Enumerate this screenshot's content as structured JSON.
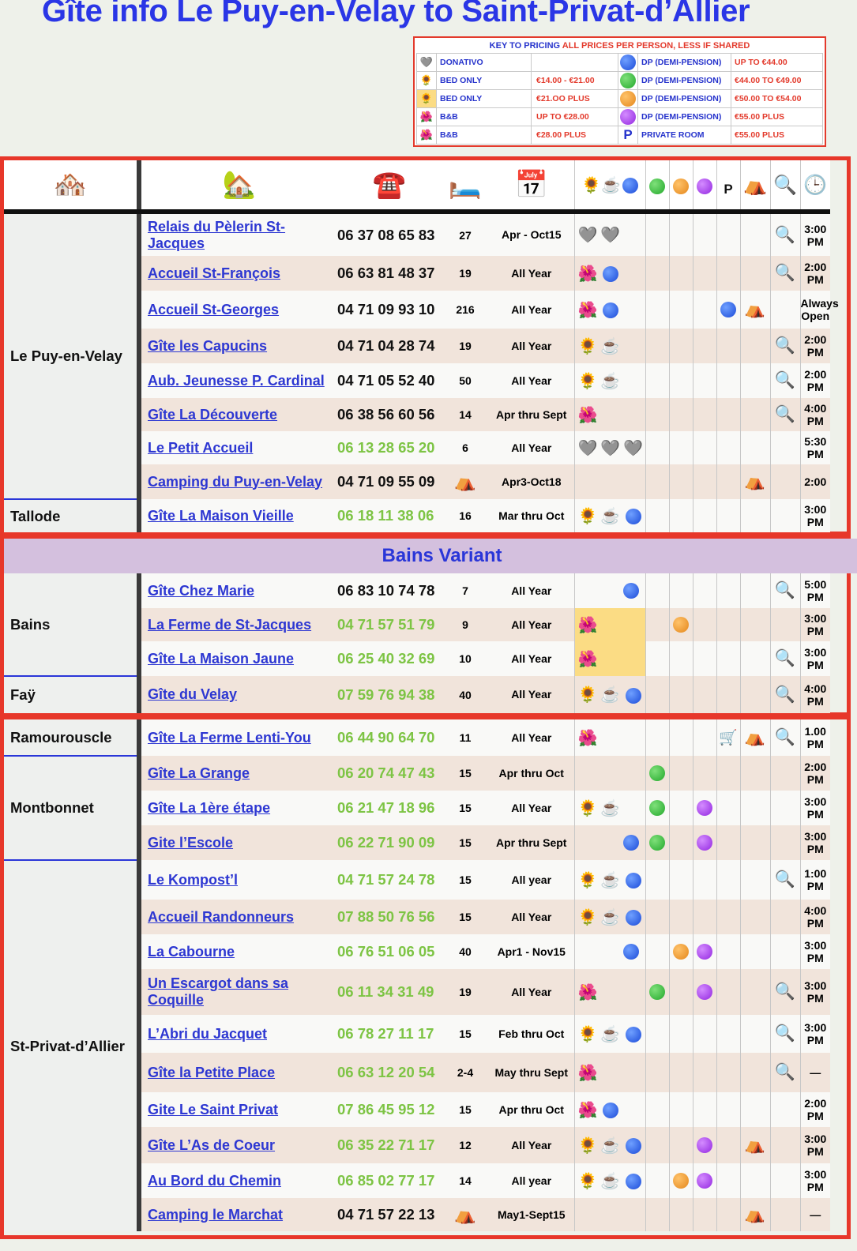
{
  "title": "Gîte info Le Puy-en-Velay to Saint-Privat-d’Allier",
  "key": {
    "heading_a": "KEY TO PRICING ",
    "heading_b": "ALL PRICES PER PERSON, LESS IF SHARED",
    "rows": [
      {
        "icon_a": "🩶",
        "label_a": "DONATIVO",
        "price_a": "",
        "icon_b": "blue-dot",
        "label_b": "DP (DEMI-PENSION)",
        "price_b": "UP TO €44.00"
      },
      {
        "icon_a": "🌻",
        "label_a": "BED ONLY",
        "price_a": "€14.00 - €21.00",
        "icon_b": "green-dot",
        "label_b": "DP (DEMI-PENSION)",
        "price_b": "€44.00 TO €49.00"
      },
      {
        "icon_a": "🌻",
        "label_a": "BED ONLY",
        "price_a": "€21.OO PLUS",
        "icon_b": "orange-dot",
        "label_b": "DP (DEMI-PENSION)",
        "price_b": "€50.00 TO €54.00"
      },
      {
        "icon_a": "🌺",
        "label_a": "B&B",
        "price_a": "UP TO €28.00",
        "icon_b": "purple-dot",
        "label_b": "DP (DEMI-PENSION)",
        "price_b": "€55.00 PLUS"
      },
      {
        "icon_a": "🌺",
        "label_a": "B&B",
        "price_a": "€28.00 PLUS",
        "icon_b": "P",
        "label_b": "PRIVATE ROOM",
        "price_b": "€55.00 PLUS"
      }
    ]
  },
  "header_icons": [
    "house-icon",
    "tree-house-icon",
    "telephone-icon",
    "bed-icon",
    "calendar-icon",
    "sunflower-icon",
    "coffee-icon",
    "blue-dot",
    "green-dot",
    "orange-dot",
    "purple-dot",
    "P",
    "tent-icon",
    "magnifier-icon",
    "clock-icon"
  ],
  "header_glyphs": {
    "house": "🏘️",
    "tree": "🏡",
    "phone": "☎️",
    "bed": "🛏️",
    "cal": "📅",
    "sun": "🌻",
    "coffee": "☕",
    "p": "P",
    "tent": "⛺",
    "mag": "🔍",
    "clock": "🕒"
  },
  "section1": {
    "rows": [
      {
        "loc": "",
        "name": "Relais du Pèlerin St-Jacques",
        "phone": "06 37 08 65 83",
        "pc": "b",
        "beds": "27",
        "open": "Apr - Oct15",
        "time": "3:00 PM"
      },
      {
        "loc": "",
        "name": "Accueil St-François",
        "phone": "06 63 81 48 37",
        "pc": "b",
        "beds": "19",
        "open": "All Year",
        "time": "2:00 PM"
      },
      {
        "loc": "",
        "name": "Accueil St-Georges",
        "phone": "04 71 09 93 10",
        "pc": "b",
        "beds": "216",
        "open": "All Year",
        "time": "Always Open"
      },
      {
        "loc": "Le Puy-en-Velay",
        "name": "Gîte les Capucins",
        "phone": "04 71 04 28 74",
        "pc": "b",
        "beds": "19",
        "open": "All Year",
        "time": "2:00 PM"
      },
      {
        "loc": "",
        "name": "Aub. Jeunesse P. Cardinal",
        "phone": "04 71 05 52 40",
        "pc": "b",
        "beds": "50",
        "open": "All Year",
        "time": "2:00 PM"
      },
      {
        "loc": "",
        "name": "Gîte La Découverte",
        "phone": "06 38 56 60 56",
        "pc": "b",
        "beds": "14",
        "open": "Apr thru Sept",
        "time": "4:00 PM"
      },
      {
        "loc": "",
        "name": "Le Petit Accueil",
        "phone": "06 13 28 65 20",
        "pc": "g",
        "beds": "6",
        "open": "All Year",
        "time": "5:30 PM"
      },
      {
        "loc": "",
        "name": "Camping du Puy-en-Velay",
        "phone": "04 71 09 55 09",
        "pc": "b",
        "beds": "⛺",
        "open": "Apr3-Oct18",
        "time": "2:00"
      },
      {
        "loc": "Tallode",
        "name": "Gîte La Maison Vieille",
        "phone": "06 18 11 38 06",
        "pc": "g",
        "beds": "16",
        "open": "Mar thru Oct",
        "time": "3:00 PM"
      }
    ]
  },
  "section2": {
    "band": "Bains Variant",
    "rows": [
      {
        "loc": "Bains",
        "name": "Gîte Chez Marie",
        "phone": "06 83 10 74 78",
        "pc": "b",
        "beds": "7",
        "open": "All Year",
        "time": "5:00 PM"
      },
      {
        "loc": "",
        "name": "La Ferme de St-Jacques",
        "phone": "04 71 57 51 79",
        "pc": "g",
        "beds": "9",
        "open": "All Year",
        "time": "3:00 PM"
      },
      {
        "loc": "",
        "name": "Gîte La Maison Jaune",
        "phone": "06 25 40 32 69",
        "pc": "g",
        "beds": "10",
        "open": "All Year",
        "time": "3:00 PM"
      },
      {
        "loc": "Faÿ",
        "name": "Gîte du Velay",
        "phone": "07 59 76 94 38",
        "pc": "g",
        "beds": "40",
        "open": "All Year",
        "time": "4:00 PM"
      }
    ]
  },
  "section3": {
    "rows": [
      {
        "loc": "Ramourouscle",
        "name": "Gîte La Ferme Lenti-You",
        "phone": "06 44 90 64 70",
        "pc": "g",
        "beds": "11",
        "open": "All Year",
        "time": "1.00 PM"
      },
      {
        "loc": "",
        "name": "Gîte La Grange",
        "phone": "06 20 74 47 43",
        "pc": "g",
        "beds": "15",
        "open": "Apr thru Oct",
        "time": "2:00 PM"
      },
      {
        "loc": "Montbonnet",
        "name": "Gîte La 1ère étape",
        "phone": "06 21 47 18 96",
        "pc": "g",
        "beds": "15",
        "open": "All Year",
        "time": "3:00 PM"
      },
      {
        "loc": "",
        "name": "Gite l’Escole",
        "phone": "06 22 71 90 09",
        "pc": "g",
        "beds": "15",
        "open": "Apr thru Sept",
        "time": "3:00 PM"
      },
      {
        "loc": "",
        "name": "Le Kompost’l",
        "phone": "04 71 57 24 78",
        "pc": "g",
        "beds": "15",
        "open": "All year",
        "time": "1:00 PM"
      },
      {
        "loc": "",
        "name": "Accueil Randonneurs",
        "phone": "07 88 50 76 56",
        "pc": "g",
        "beds": "15",
        "open": "All Year",
        "time": "4:00 PM"
      },
      {
        "loc": "",
        "name": "La  Cabourne",
        "phone": "06 76 51 06 05",
        "pc": "g",
        "beds": "40",
        "open": "Apr1 - Nov15",
        "time": "3:00 PM"
      },
      {
        "loc": "",
        "name": "Un Escargot dans sa Coquille",
        "phone": "06 11 34 31 49",
        "pc": "g",
        "beds": "19",
        "open": "All Year",
        "time": "3:00 PM"
      },
      {
        "loc": "St-Privat-d’Allier",
        "name": "L’Abri du Jacquet",
        "phone": "06 78 27 11 17",
        "pc": "g",
        "beds": "15",
        "open": "Feb thru Oct",
        "time": "3:00 PM"
      },
      {
        "loc": "",
        "name": "Gîte la Petite Place",
        "phone": "06 63 12 20 54",
        "pc": "g",
        "beds": "2-4",
        "open": "May thru Sept",
        "time": "—"
      },
      {
        "loc": "",
        "name": "Gite Le Saint Privat",
        "phone": "07 86 45 95 12",
        "pc": "g",
        "beds": "15",
        "open": "Apr thru Oct",
        "time": "2:00 PM"
      },
      {
        "loc": "",
        "name": "Gîte L’As de Coeur",
        "phone": "06 35 22 71 17",
        "pc": "g",
        "beds": "12",
        "open": "All Year",
        "time": "3:00 PM"
      },
      {
        "loc": "",
        "name": "Au Bord du Chemin",
        "phone": "06 85 02 77 17",
        "pc": "g",
        "beds": "14",
        "open": "All year",
        "time": "3:00 PM"
      },
      {
        "loc": "",
        "name": "Camping le Marchat",
        "phone": "04 71 57 22 13",
        "pc": "b",
        "beds": "⛺",
        "open": "May1-Sept15",
        "time": "—"
      }
    ]
  },
  "glyphs": {
    "heart": "🩶",
    "sun": "🌻",
    "coffee": "☕",
    "flower": "🌺",
    "tent": "⛺",
    "mag": "🔍",
    "cart": "🛒"
  }
}
